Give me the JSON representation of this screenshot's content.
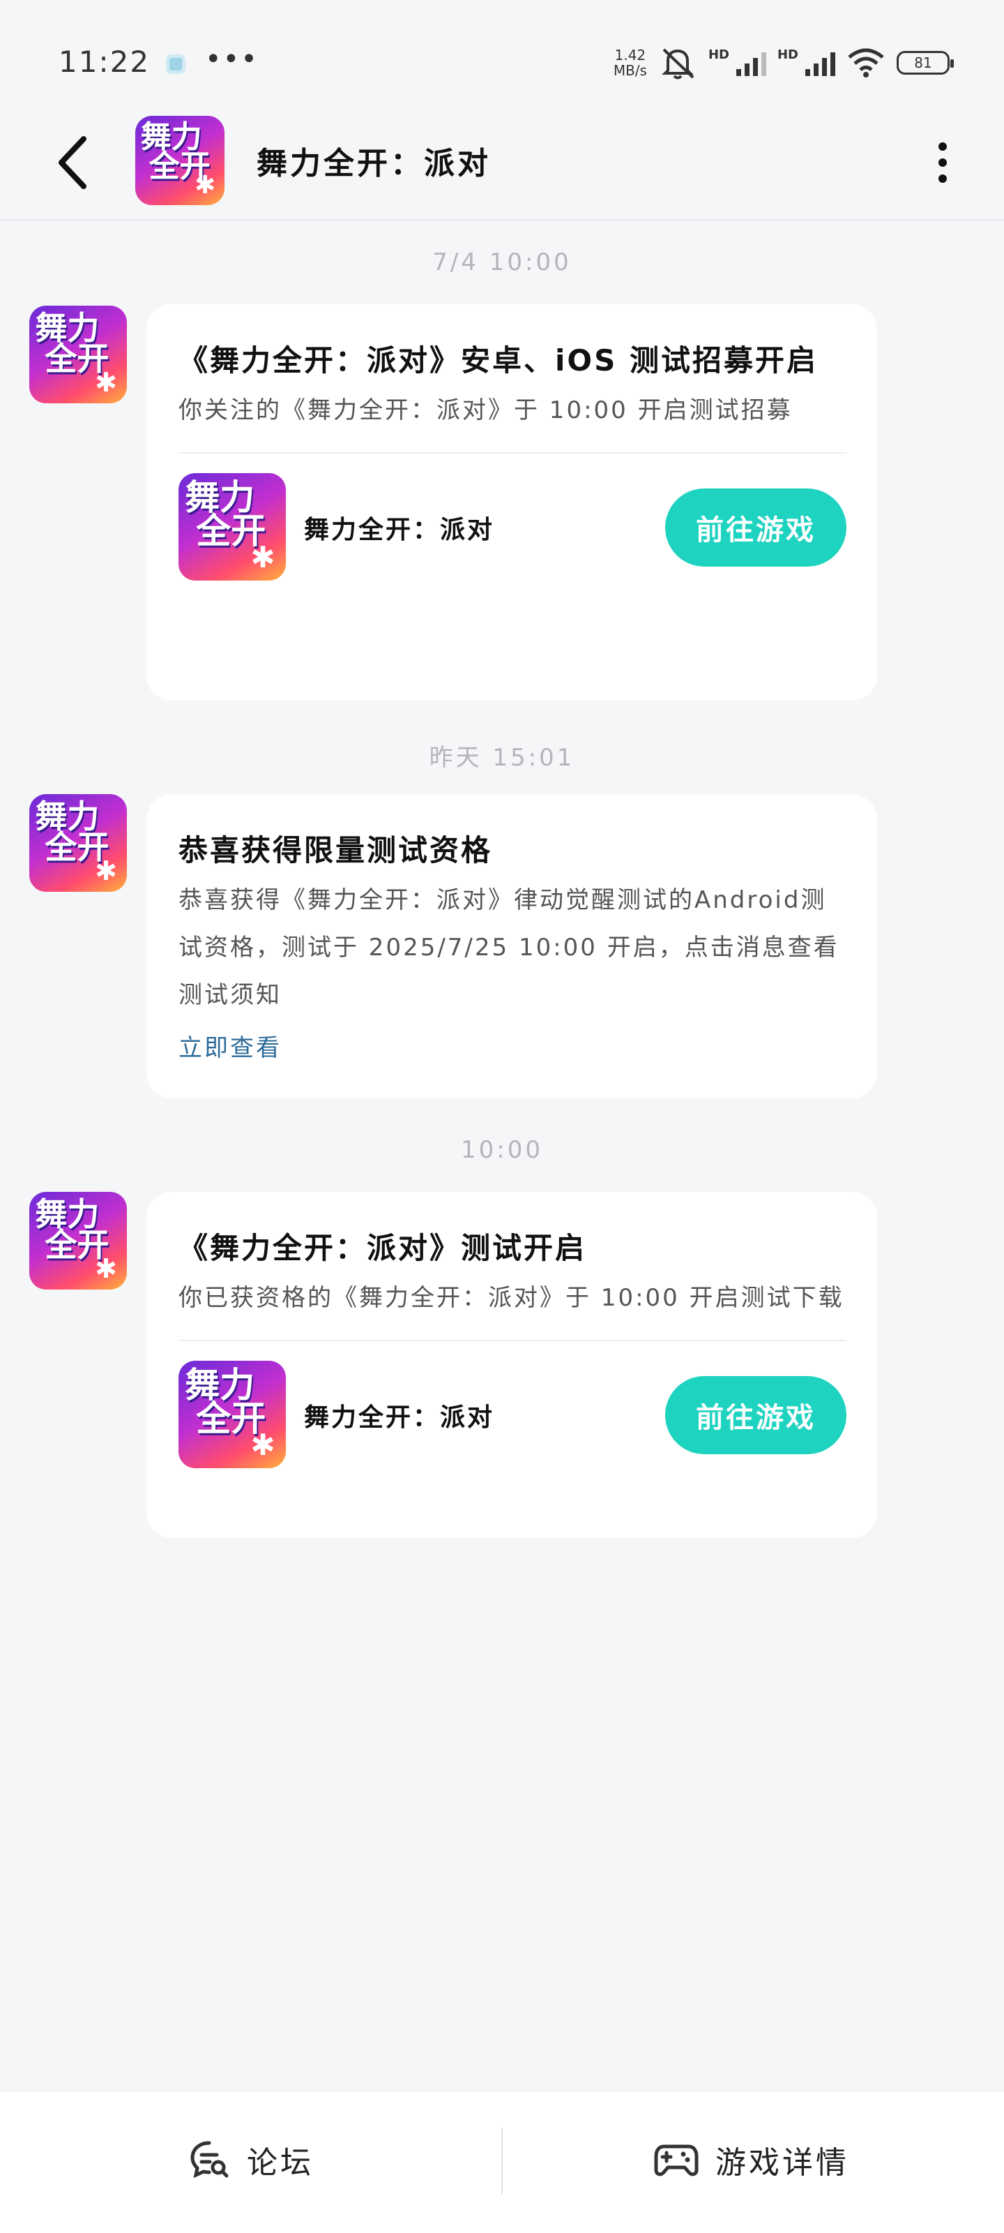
{
  "status_bar": {
    "time": "11:22",
    "more": "•••",
    "net_speed_value": "1.42",
    "net_speed_unit": "MB/s",
    "hd1": "HD",
    "hd2": "HD",
    "battery": "81"
  },
  "header": {
    "title": "舞力全开：派对"
  },
  "logo": {
    "glyph_top": "舞力",
    "glyph_bottom": "全开",
    "colors": [
      "#6a2bd8",
      "#c12fd0",
      "#ff4d6d",
      "#ffb13b"
    ]
  },
  "messages": [
    {
      "timestamp": "7/4  10:00",
      "title": "《舞力全开：派对》安卓、iOS 测试招募开启",
      "body": "你关注的《舞力全开：派对》于 10:00 开启测试招募",
      "game_name": "舞力全开：派对",
      "button": "前往游戏"
    },
    {
      "timestamp": "昨天  15:01",
      "title": "恭喜获得限量测试资格",
      "body": "恭喜获得《舞力全开：派对》律动觉醒测试的Android测试资格，测试于 2025/7/25 10:00 开启，点击消息查看测试须知",
      "link": "立即查看"
    },
    {
      "timestamp": "10:00",
      "title": "《舞力全开：派对》测试开启",
      "body": "你已获资格的《舞力全开：派对》于 10:00 开启测试下载",
      "game_name": "舞力全开：派对",
      "button": "前往游戏"
    }
  ],
  "bottom_bar": {
    "forum_label": "论坛",
    "detail_label": "游戏详情"
  },
  "colors": {
    "accent": "#1ed3c0",
    "link": "#2d6b9a",
    "background": "#f5f6f8"
  }
}
